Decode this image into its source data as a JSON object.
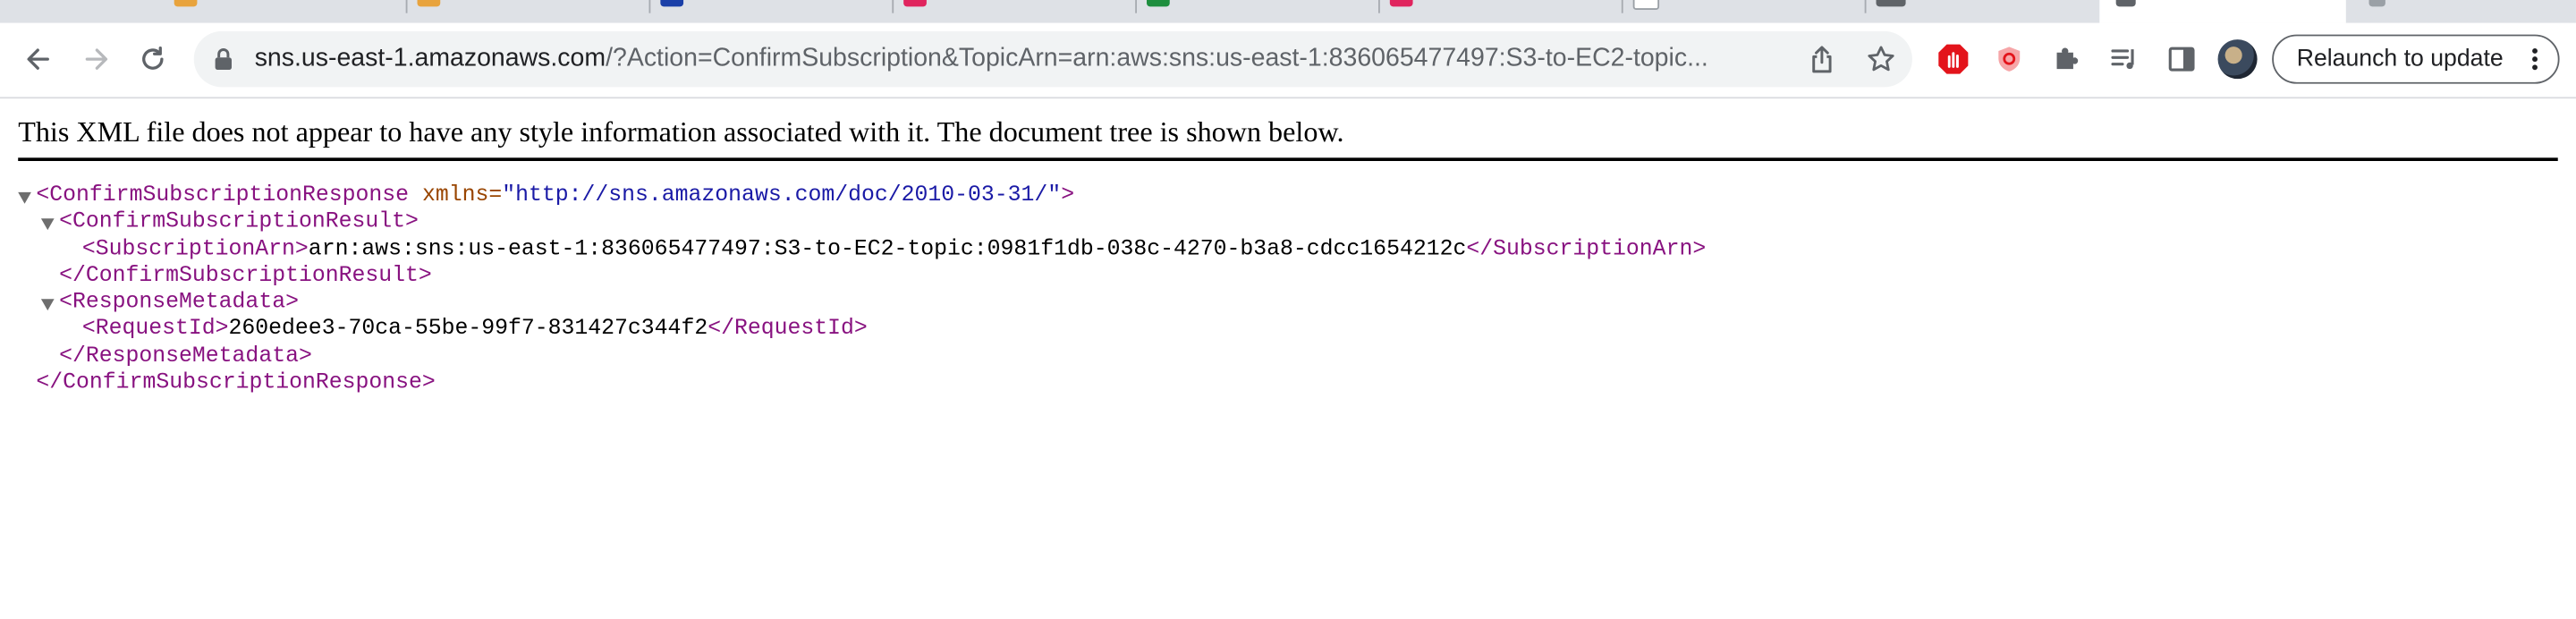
{
  "browser": {
    "url_host": "sns.us-east-1.amazonaws.com",
    "url_rest": "/?Action=ConfirmSubscription&TopicArn=arn:aws:sns:us-east-1:836065477497:S3-to-EC2-topic...",
    "relaunch_label": "Relaunch to update",
    "tab_favicon_colors": [
      "#e8a33d",
      "#e8a33d",
      "#1a3fa8",
      "#e0245e",
      "#1e8e3e",
      "#e0245e",
      "#9aa0a6",
      "#5f6368"
    ]
  },
  "viewer": {
    "notice": "This XML file does not appear to have any style information associated with it. The document tree is shown below."
  },
  "xml": {
    "root_open": "<ConfirmSubscriptionResponse",
    "root_attr_name": "xmlns=",
    "root_attr_value": "\"http://sns.amazonaws.com/doc/2010-03-31/\"",
    "root_open_end": ">",
    "result_open": "<ConfirmSubscriptionResult>",
    "arn_open": "<SubscriptionArn>",
    "arn_value": "arn:aws:sns:us-east-1:836065477497:S3-to-EC2-topic:0981f1db-038c-4270-b3a8-cdcc1654212c",
    "arn_close": "</SubscriptionArn>",
    "result_close": "</ConfirmSubscriptionResult>",
    "meta_open": "<ResponseMetadata>",
    "reqid_open": "<RequestId>",
    "reqid_value": "260edee3-70ca-55be-99f7-831427c344f2",
    "reqid_close": "</RequestId>",
    "meta_close": "</ResponseMetadata>",
    "root_close": "</ConfirmSubscriptionResponse>"
  },
  "colors": {
    "tag": "#881280",
    "attr_name": "#994500",
    "attr_value": "#1a1aa6"
  }
}
